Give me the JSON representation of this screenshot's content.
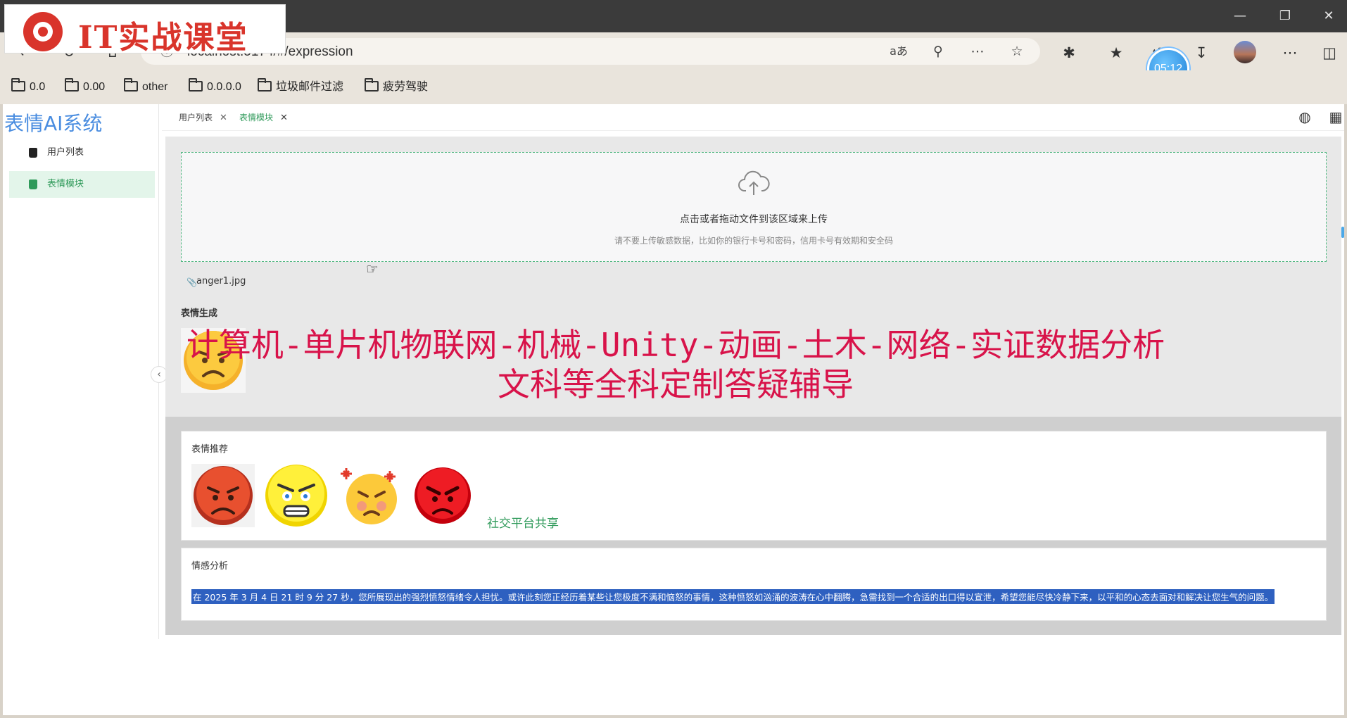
{
  "browser": {
    "url": "localhost:5174/#/expression",
    "clock": "05:12",
    "bookmarks": [
      "0.0",
      "0.00",
      "other",
      "0.0.0.0",
      "垃圾邮件过滤",
      "疲劳驾驶"
    ]
  },
  "watermark": {
    "logo_text": "IT实战课堂",
    "banner_line1": "计算机-单片机物联网-机械-Unity-动画-土木-网络-实证数据分析",
    "banner_line2": "文科等全科定制答疑辅导"
  },
  "app": {
    "system_title": "表情AI系统",
    "menu": [
      {
        "label": "用户列表",
        "active": false
      },
      {
        "label": "表情模块",
        "active": true
      }
    ],
    "tabs": [
      {
        "label": "用户列表",
        "active": false
      },
      {
        "label": "表情模块",
        "active": true
      }
    ]
  },
  "upload": {
    "title": "点击或者拖动文件到该区域来上传",
    "hint": "请不要上传敏感数据，比如你的银行卡号和密码，信用卡号有效期和安全码",
    "file_name": "anger1.jpg"
  },
  "generation": {
    "section_title": "表情生成",
    "emoji": "frown-face"
  },
  "recommend": {
    "section_title": "表情推荐",
    "emojis": [
      "red-angry-face",
      "yellow-angry-face",
      "fuming-face",
      "red-angry-face-2"
    ],
    "share_label": "社交平台共享"
  },
  "analysis": {
    "section_title": "情感分析",
    "text": "在 2025 年 3 月 4 日 21 时 9 分 27 秒，您所展现出的强烈愤怒情绪令人担忧。或许此刻您正经历着某些让您极度不满和恼怒的事情，这种愤怒如汹涌的波涛在心中翻腾，急需找到一个合适的出口得以宣泄，希望您能尽快冷静下来，以平和的心态去面对和解决让您生气的问题。"
  },
  "colors": {
    "accent": "#2f9a5a",
    "title_blue": "#4a8de0",
    "watermark_red": "#d8134a"
  }
}
